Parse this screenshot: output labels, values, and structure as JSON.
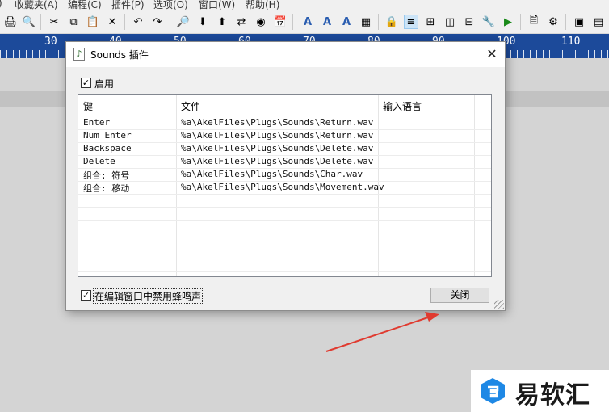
{
  "app": {
    "menu": [
      "收藏夹(A)",
      "编程(C)",
      "插件(P)",
      "选项(O)",
      "窗口(W)",
      "帮助(H)"
    ],
    "ruler_numbers": [
      "30",
      "40",
      "50",
      "60",
      "70",
      "80",
      "90",
      "100",
      "110"
    ],
    "toolbar_icons": [
      "print-icon",
      "print-preview-icon",
      "cut-icon",
      "copy-icon",
      "paste-icon",
      "delete-icon",
      "undo-icon",
      "redo-icon",
      "find-icon",
      "find-down-icon",
      "find-up-icon",
      "replace-icon",
      "goto-icon",
      "insert-date-icon",
      "font-icon",
      "font-bold-icon",
      "font-color-icon",
      "charmap-icon",
      "read-only-icon",
      "word-wrap-icon",
      "split-window-icon",
      "split-vertical-icon",
      "split-horizontal-icon",
      "settings-icon",
      "run-icon",
      "plugins-icon",
      "sound-icon",
      "window-list-icon",
      "stats-icon"
    ],
    "ruler_color": "#1c4a9a"
  },
  "dialog": {
    "title": "Sounds 插件",
    "title_icon": "music-note-icon",
    "close_symbol": "✕",
    "enable_label": "启用",
    "enable_checked": true,
    "columns": [
      "键",
      "文件",
      "输入语言"
    ],
    "rows": [
      {
        "key": "Enter",
        "file": "%a\\AkelFiles\\Plugs\\Sounds\\Return.wav",
        "lang": ""
      },
      {
        "key": "Num Enter",
        "file": "%a\\AkelFiles\\Plugs\\Sounds\\Return.wav",
        "lang": ""
      },
      {
        "key": "Backspace",
        "file": "%a\\AkelFiles\\Plugs\\Sounds\\Delete.wav",
        "lang": ""
      },
      {
        "key": "Delete",
        "file": "%a\\AkelFiles\\Plugs\\Sounds\\Delete.wav",
        "lang": ""
      },
      {
        "key": "组合: 符号",
        "file": "%a\\AkelFiles\\Plugs\\Sounds\\Char.wav",
        "lang": ""
      },
      {
        "key": "组合: 移动",
        "file": "%a\\AkelFiles\\Plugs\\Sounds\\Movement.wav",
        "lang": ""
      }
    ],
    "disable_label": "在编辑窗口中禁用蜂鸣声",
    "disable_checked": true,
    "close_button": "关闭"
  },
  "annotation": {
    "arrow_color": "#e03a2f"
  },
  "watermark": {
    "text": "易软汇"
  }
}
